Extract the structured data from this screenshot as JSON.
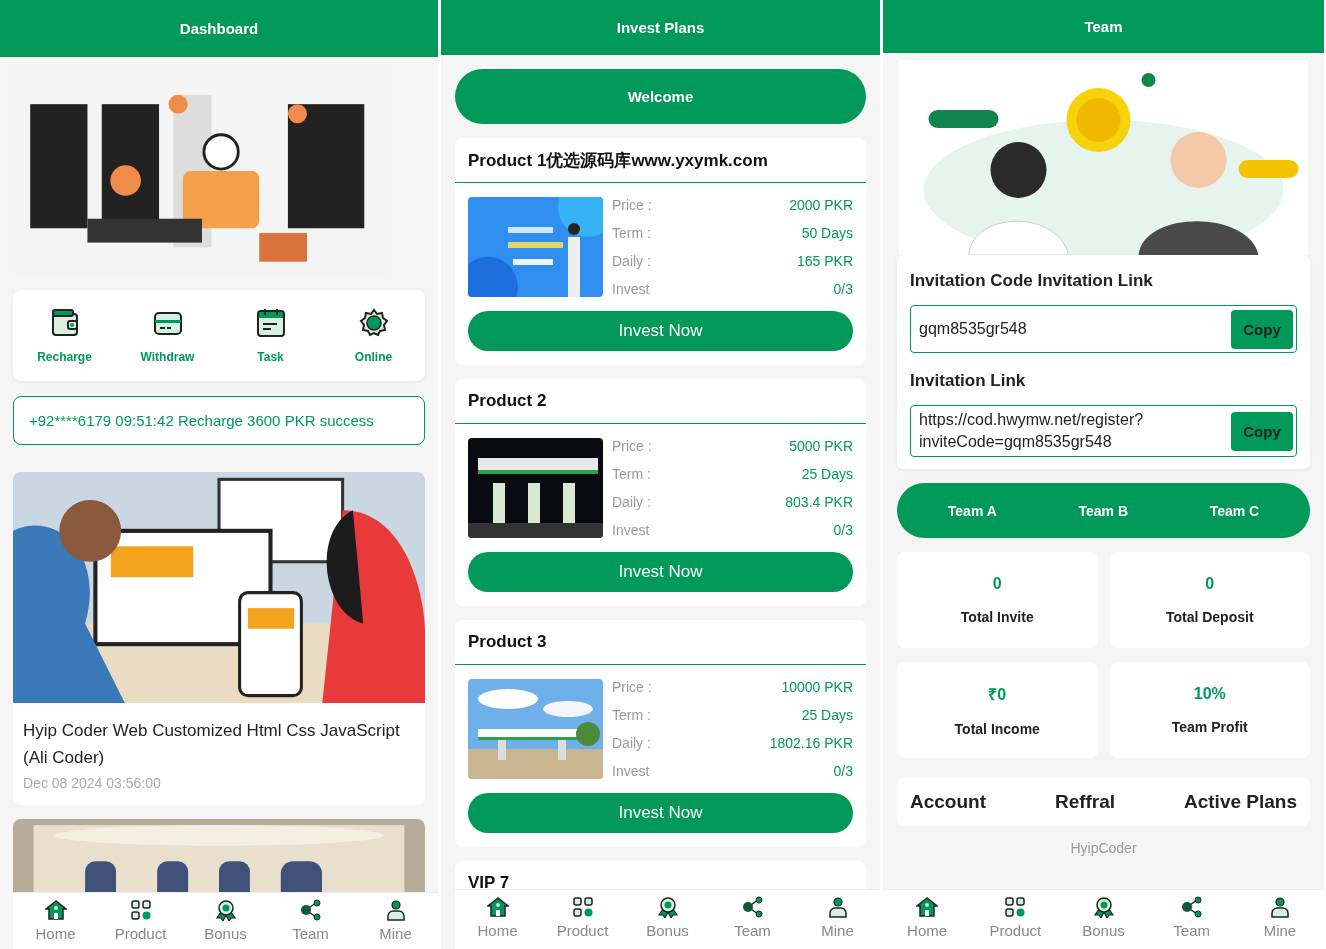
{
  "dashboard": {
    "title": "Dashboard",
    "banner": {
      "kind": "picture"
    },
    "actions": [
      {
        "label": "Recharge"
      },
      {
        "label": "Withdraw"
      },
      {
        "label": "Task"
      },
      {
        "label": "Online"
      }
    ],
    "notice": "+92****6179 09:51:42 Recharge 3600 PKR success",
    "articles": [
      {
        "kind": "post",
        "title": "Hyip Coder Web Customized Html Css JavaScript (Ali Coder)",
        "date": "Dec 08 2024 03:56:00"
      },
      {
        "kind": "picture"
      }
    ],
    "nav": [
      {
        "label": "Home"
      },
      {
        "label": "Product"
      },
      {
        "label": "Bonus"
      },
      {
        "label": "Team"
      },
      {
        "label": "Mine"
      }
    ]
  },
  "invest_plans": {
    "title": "Invest Plans",
    "welcome": "Welcome",
    "products": [
      {
        "name": "Product 1优选源码库www.yxymk.com",
        "rows": [
          {
            "label": "Price :",
            "value": "2000 PKR"
          },
          {
            "label": "Term :",
            "value": "50 Days"
          },
          {
            "label": "Daily :",
            "value": "165 PKR"
          },
          {
            "label": "Invest",
            "value": "0/3"
          }
        ],
        "button": "Invest Now"
      },
      {
        "name": "Product 2",
        "rows": [
          {
            "label": "Price :",
            "value": "5000 PKR"
          },
          {
            "label": "Term :",
            "value": "25 Days"
          },
          {
            "label": "Daily :",
            "value": "803.4 PKR"
          },
          {
            "label": "Invest",
            "value": "0/3"
          }
        ],
        "button": "Invest Now"
      },
      {
        "name": "Product 3",
        "rows": [
          {
            "label": "Price :",
            "value": "10000 PKR"
          },
          {
            "label": "Term :",
            "value": "25 Days"
          },
          {
            "label": "Daily :",
            "value": "1802.16 PKR"
          },
          {
            "label": "Invest",
            "value": "0/3"
          }
        ],
        "button": "Invest Now"
      },
      {
        "name": "VIP 7"
      }
    ],
    "nav": [
      {
        "label": "Home"
      },
      {
        "label": "Product"
      },
      {
        "label": "Bonus"
      },
      {
        "label": "Team"
      },
      {
        "label": "Mine"
      }
    ]
  },
  "team": {
    "title": "Team",
    "illustration": {
      "kind": "picture"
    },
    "invite": {
      "code_heading": "Invitation Code Invitation Link",
      "code": "gqm8535gr548",
      "code_button": "Copy",
      "link_heading": "Invitation Link",
      "link": "https://cod.hwymw.net/register?inviteCode=gqm8535gr548",
      "link_button": "Copy"
    },
    "tabs": [
      "Team A",
      "Team B",
      "Team C"
    ],
    "stats": [
      {
        "value": "0",
        "label": "Total Invite"
      },
      {
        "value": "0",
        "label": "Total Deposit"
      },
      {
        "value": "₹0",
        "label": "Total Income"
      },
      {
        "value": "10%",
        "label": "Team Profit"
      }
    ],
    "links": [
      "Account",
      "Reffral",
      "Active Plans"
    ],
    "footer": "HyipCoder",
    "nav": [
      {
        "label": "Home"
      },
      {
        "label": "Product"
      },
      {
        "label": "Bonus"
      },
      {
        "label": "Team"
      },
      {
        "label": "Mine"
      }
    ]
  }
}
